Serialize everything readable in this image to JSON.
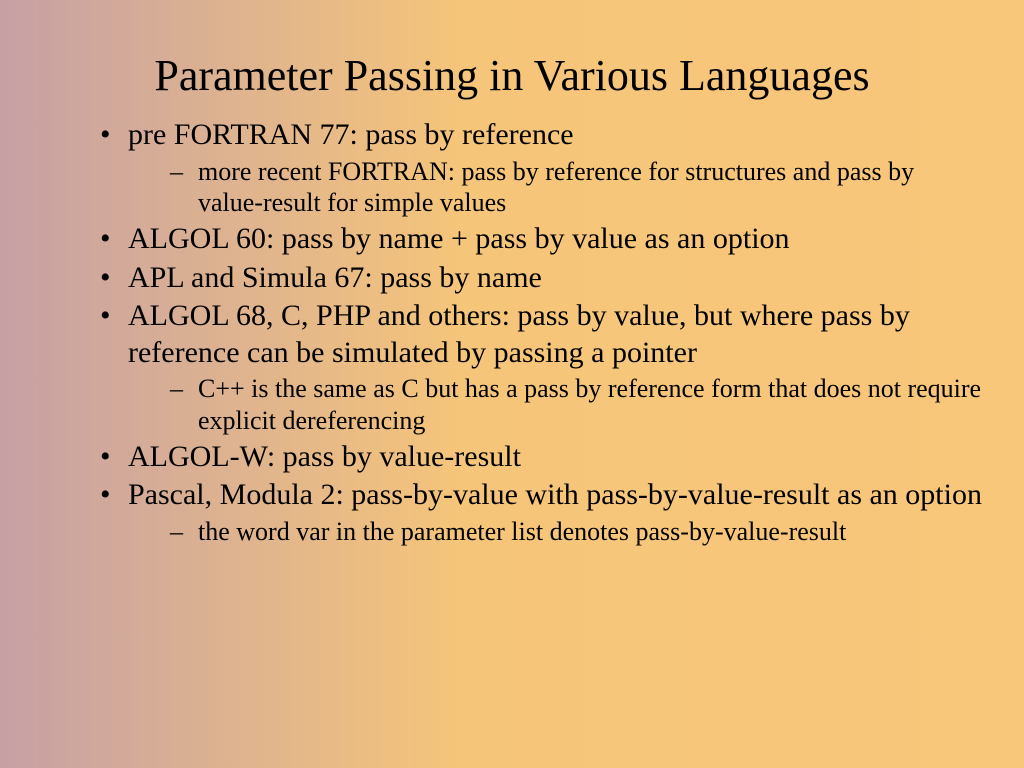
{
  "title": "Parameter Passing in Various Languages",
  "bullets": [
    {
      "text": "pre FORTRAN 77:  pass by reference",
      "sub": [
        "more recent FORTRAN:  pass by reference for structures and pass by value-result for simple values"
      ]
    },
    {
      "text": "ALGOL 60:  pass by name + pass by value as an option",
      "sub": []
    },
    {
      "text": "APL and Simula 67:  pass by name",
      "sub": []
    },
    {
      "text": "ALGOL 68, C, PHP and others:  pass by value, but where pass by reference can be simulated by passing a pointer",
      "sub": [
        "C++ is the same as C but has a pass by reference form that does not require explicit dereferencing"
      ]
    },
    {
      "text": "ALGOL-W:  pass by value-result",
      "sub": []
    },
    {
      "text": "Pascal, Modula 2:  pass-by-value with pass-by-value-result as an option",
      "sub": [
        "the word var in the parameter list denotes pass-by-value-result"
      ]
    }
  ]
}
